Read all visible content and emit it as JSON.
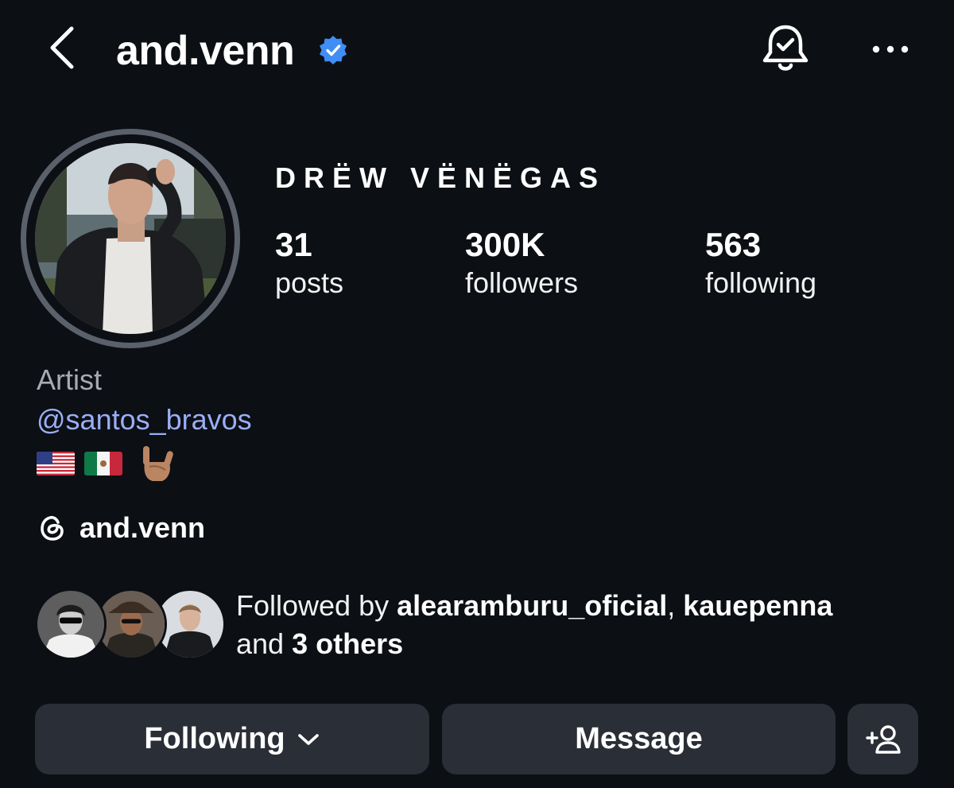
{
  "header": {
    "username": "and.venn",
    "verified": true,
    "icons": [
      "back-icon",
      "verified-badge-icon",
      "notification-bell-icon",
      "more-options-icon"
    ]
  },
  "profile": {
    "display_name": "DRËW VËNËGAS",
    "stats": {
      "posts": {
        "value": "31",
        "label": "posts"
      },
      "followers": {
        "value": "300K",
        "label": "followers"
      },
      "following": {
        "value": "563",
        "label": "following"
      }
    },
    "category": "Artist",
    "bio_mention": "@santos_bravos",
    "bio_emojis": [
      "us-flag",
      "mexico-flag",
      "rock-on-hand"
    ],
    "threads_handle": "and.venn"
  },
  "followed_by": {
    "prefix": "Followed by ",
    "user1": "alearamburu_oficial",
    "separator": ", ",
    "user2": "kauepenna",
    "middle": "and ",
    "others": "3 others"
  },
  "actions": {
    "following_label": "Following",
    "message_label": "Message"
  },
  "colors": {
    "background": "#0c0f14",
    "button": "#2a2e36",
    "link": "#9aaef5",
    "verified": "#3f8df5",
    "muted": "#a7abb2"
  }
}
